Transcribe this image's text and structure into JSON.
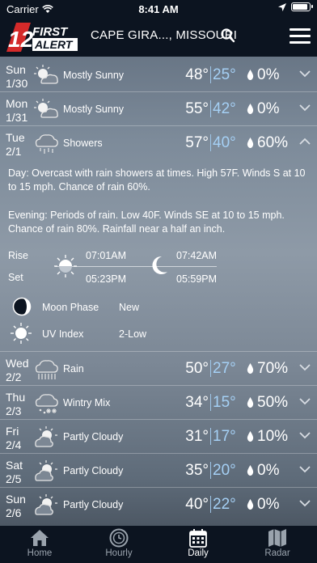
{
  "status_bar": {
    "carrier": "Carrier",
    "time": "8:41 AM"
  },
  "header": {
    "logo_number": "12",
    "logo_first": "FIRST",
    "logo_alert": "ALERT",
    "location": "CAPE GIRA..., MISSOURI"
  },
  "forecast": [
    {
      "day": "Sun",
      "date": "1/30",
      "icon": "mostly-sunny-icon",
      "condition": "Mostly Sunny",
      "high": "48°",
      "low": "25°",
      "precip": "0%"
    },
    {
      "day": "Mon",
      "date": "1/31",
      "icon": "mostly-sunny-icon",
      "condition": "Mostly Sunny",
      "high": "55°",
      "low": "42°",
      "precip": "0%"
    },
    {
      "day": "Tue",
      "date": "2/1",
      "icon": "showers-icon",
      "condition": "Showers",
      "high": "57°",
      "low": "40°",
      "precip": "60%",
      "expanded": true
    }
  ],
  "details": {
    "day_label": "Day",
    "day_text": ": Overcast with rain showers at times. High 57F. Winds S at 10 to 15 mph. Chance of rain 60%.",
    "evening_label": "Evening",
    "evening_text": ": Periods of rain. Low 40F. Winds SE at 10 to 15 mph. Chance of rain 80%. Rainfall near a half an inch.",
    "rise_label": "Rise",
    "set_label": "Set",
    "sunrise": "07:01AM",
    "sunset": "05:23PM",
    "moonrise": "07:42AM",
    "moonset": "05:59PM",
    "moon_phase_label": "Moon Phase",
    "moon_phase": "New",
    "uv_label": "UV Index",
    "uv_value": "2-Low"
  },
  "forecast2": [
    {
      "day": "Wed",
      "date": "2/2",
      "icon": "rain-icon",
      "condition": "Rain",
      "high": "50°",
      "low": "27°",
      "precip": "70%"
    },
    {
      "day": "Thu",
      "date": "2/3",
      "icon": "wintry-mix-icon",
      "condition": "Wintry Mix",
      "high": "34°",
      "low": "15°",
      "precip": "50%"
    },
    {
      "day": "Fri",
      "date": "2/4",
      "icon": "partly-cloudy-icon",
      "condition": "Partly Cloudy",
      "high": "31°",
      "low": "17°",
      "precip": "10%"
    },
    {
      "day": "Sat",
      "date": "2/5",
      "icon": "partly-cloudy-icon",
      "condition": "Partly Cloudy",
      "high": "35°",
      "low": "20°",
      "precip": "0%"
    },
    {
      "day": "Sun",
      "date": "2/6",
      "icon": "partly-cloudy-icon",
      "condition": "Partly Cloudy",
      "high": "40°",
      "low": "22°",
      "precip": "0%"
    }
  ],
  "tabbar": [
    {
      "label": "Home",
      "icon": "home-icon"
    },
    {
      "label": "Hourly",
      "icon": "clock-icon"
    },
    {
      "label": "Daily",
      "icon": "calendar-icon",
      "active": true
    },
    {
      "label": "Radar",
      "icon": "map-icon"
    }
  ],
  "colors": {
    "header_bg": "#0c1420",
    "low_temp": "#a5d0f5",
    "tab_active": "#ffffff",
    "tab_inactive": "#9aa3ad",
    "logo_red": "#d42a2a"
  }
}
